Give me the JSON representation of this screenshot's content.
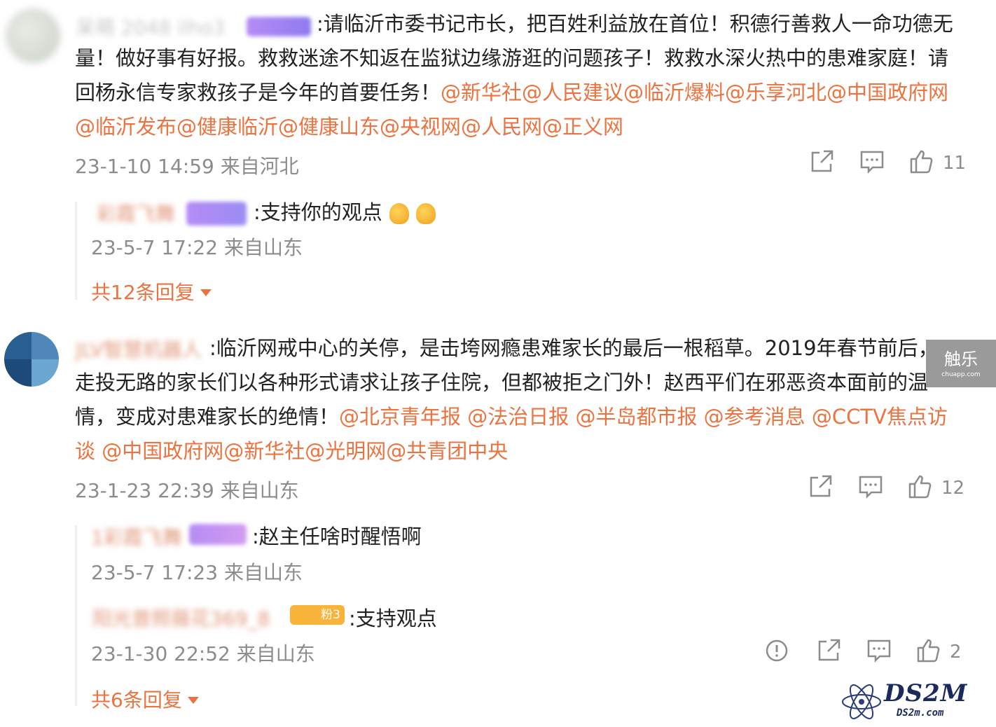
{
  "comments": [
    {
      "user_name": "呆萌 2048 ilho3",
      "body_plain": ":请临沂市委书记市长，把百姓利益放在首位！积德行善救人一命功德无量！做好事有好报。救救迷途不知返在监狱边缘游逛的问题孩子！救救水深火热中的患难家庭！请回杨永信专家救孩子是今年的首要任务！",
      "body_mentions": "@新华社@人民建议@临沂爆料@乐享河北@中国政府网@临沂发布@健康临沂@健康山东@央视网@人民网@正义网",
      "meta": "23-1-10 14:59 来自河北",
      "like_count": "11",
      "replies": [
        {
          "user_name": "彩霞飞舞",
          "text": ":支持你的观点",
          "meta": "23-5-7 17:22 来自山东"
        }
      ],
      "more_replies": "共12条回复"
    },
    {
      "user_name": "JLV智慧机器人",
      "body_plain": ":临沂网戒中心的关停，是击垮网瘾患难家长的最后一根稻草。2019年春节前后，走投无路的家长们以各种形式请求让孩子住院，但都被拒之门外！赵西平们在邪恶资本面前的温情，变成对患难家长的绝情！",
      "body_mentions": "@北京青年报 @法治日报 @半岛都市报 @参考消息 @CCTV焦点访谈 @中国政府网@新华社@光明网@共青团中央",
      "meta": "23-1-23 22:39 来自山东",
      "like_count": "12",
      "replies": [
        {
          "user_name": "1彩霞飞舞",
          "text": ":赵主任啥时醒悟啊",
          "meta": "23-5-7 17:23 来自山东"
        },
        {
          "user_name": "阳光普照薇花369_8",
          "badge": "粉3",
          "text": ":支持观点",
          "meta": "23-1-30 22:52 来自山东",
          "like_count": "2"
        }
      ],
      "more_replies": "共6条回复"
    }
  ],
  "watermarks": {
    "chule_main": "触乐",
    "chule_sub": "chuapp.com",
    "ds2m_main": "DS2M",
    "ds2m_sub": "DS2m.com"
  },
  "icons": [
    "share-icon",
    "comment-icon",
    "like-icon",
    "report-icon"
  ],
  "colors": {
    "mention": "#eb7340",
    "meta": "#8c8c8c",
    "text": "#222222"
  }
}
